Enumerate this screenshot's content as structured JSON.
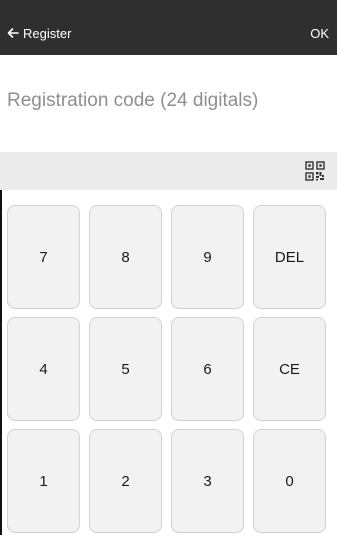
{
  "header": {
    "back_label": "Register",
    "ok_label": "OK",
    "background": "#2f2f2f"
  },
  "input": {
    "placeholder": "Registration code (24 digitals)",
    "value": ""
  },
  "toolbar": {
    "scan_icon": "qr-code-icon"
  },
  "keypad": {
    "rows": [
      [
        "7",
        "8",
        "9",
        "DEL"
      ],
      [
        "4",
        "5",
        "6",
        "CE"
      ],
      [
        "1",
        "2",
        "3",
        "0"
      ]
    ]
  }
}
